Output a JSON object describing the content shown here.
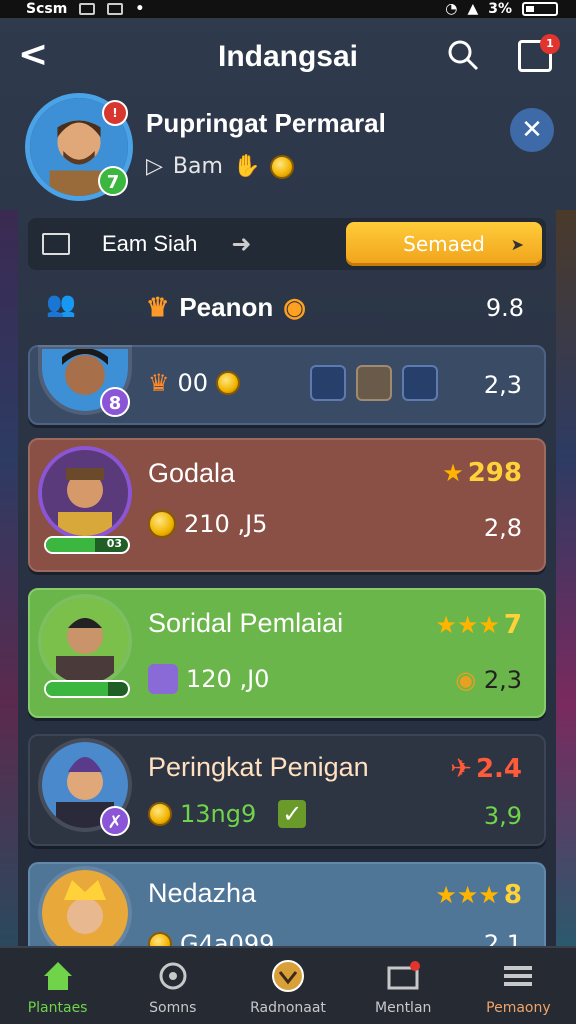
{
  "status": {
    "left_text": "Scsm",
    "battery": "3%"
  },
  "header": {
    "title": "Indangsai",
    "notif_count": "1"
  },
  "profile": {
    "name": "Pupringat Permaral",
    "sub": "Bam",
    "level": "7"
  },
  "friendbar": {
    "label": "Eam Siah",
    "button": "Semaed"
  },
  "header_row": {
    "category": "Peanon",
    "value": "9.8"
  },
  "rows": [
    {
      "name": "",
      "level": "8",
      "stat": "00",
      "value": "2,3"
    },
    {
      "name": "Godala",
      "score": "298",
      "stat": "210 ,J5",
      "value": "2,8",
      "bar": "03"
    },
    {
      "name": "Soridal Pemlaiai",
      "score": "7",
      "stat": "120 ,J0",
      "value": "2,3"
    },
    {
      "name": "Peringkat Penigan",
      "score": "2.4",
      "stat": "13ng9",
      "value": "3,9"
    },
    {
      "name": "Nedazha",
      "score": "8",
      "stat": "G4a099",
      "value": "2.1"
    }
  ],
  "tabs": [
    {
      "label": "Plantaes"
    },
    {
      "label": "Somns"
    },
    {
      "label": "Radnonaat"
    },
    {
      "label": "Mentlan"
    },
    {
      "label": "Pemaony"
    }
  ],
  "colors": {
    "accent": "#6fd44a",
    "send_button": "#f0a21a",
    "score_star": "#ffb400"
  }
}
